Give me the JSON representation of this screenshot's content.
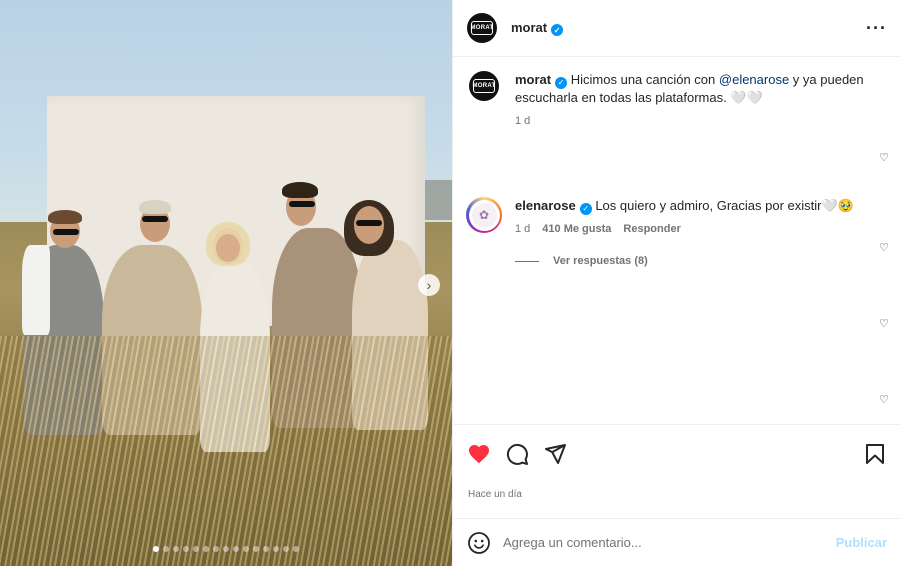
{
  "post": {
    "author": "morat",
    "avatar_text": "MORAT",
    "more_icon": "more-horizontal-icon",
    "caption_prefix": "Hicimos una canción con ",
    "caption_mention": "@elenarose",
    "caption_suffix": " y ya pueden escucharla en todas las plataformas. 🤍🤍",
    "caption_age": "1 d",
    "image_dots_total": 15,
    "image_dot_active": 0
  },
  "comment": {
    "author": "elenarose",
    "text": "Los quiero y admiro, Gracias por existir🤍🥹",
    "age": "1 d",
    "likes": "410 Me gusta",
    "reply_label": "Responder",
    "view_replies": "Ver respuestas (8)"
  },
  "footer": {
    "time_label": "Hace un día",
    "comment_placeholder": "Agrega un comentario...",
    "publish_label": "Publicar"
  },
  "colors": {
    "like_red": "#ff3040",
    "verified_blue": "#0095f6",
    "publish_disabled": "#b2dffc"
  }
}
